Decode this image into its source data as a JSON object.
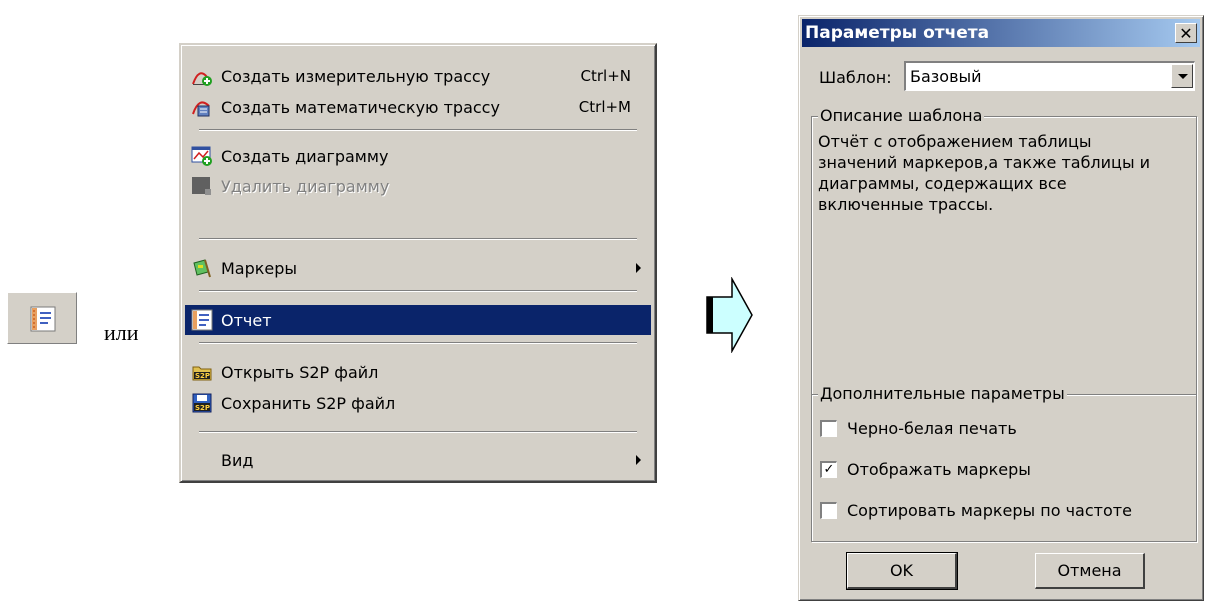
{
  "toolbar": {
    "report_icon": "report-icon",
    "or_text": "или"
  },
  "menu": {
    "items": [
      {
        "label": "Создать измерительную трассу",
        "shortcut": "Ctrl+N",
        "icon": "measure-trace-icon"
      },
      {
        "label": "Создать математическую трассу",
        "shortcut": "Ctrl+M",
        "icon": "math-trace-icon"
      },
      {
        "label": "Создать диаграмму",
        "icon": "create-chart-icon"
      },
      {
        "label": "Удалить диаграмму",
        "icon": "delete-chart-icon",
        "disabled": true
      },
      {
        "label": "Маркеры",
        "icon": "markers-icon",
        "submenu": true
      },
      {
        "label": "Отчет",
        "icon": "report-icon",
        "selected": true
      },
      {
        "label": "Открыть S2P файл",
        "icon": "open-s2p-icon"
      },
      {
        "label": "Сохранить S2P файл",
        "icon": "save-s2p-icon"
      },
      {
        "label": "Вид",
        "submenu": true
      }
    ]
  },
  "dialog": {
    "title": "Параметры отчета",
    "template_label": "Шаблон:",
    "template_value": "Базовый",
    "description_group": "Описание шаблона",
    "description_lines": [
      "Отчёт с отображением таблицы",
      "значений маркеров,а также таблицы и",
      "диаграммы, содержащих все",
      "включенные трассы."
    ],
    "extra_group": "Дополнительные параметры",
    "options": [
      {
        "label": "Черно-белая печать",
        "checked": false
      },
      {
        "label": "Отображать маркеры",
        "checked": true
      },
      {
        "label": "Сортировать маркеры по частоте",
        "checked": false
      }
    ],
    "ok_label": "OK",
    "cancel_label": "Отмена"
  },
  "colors": {
    "menu_bg": "#d4d0c8",
    "selection": "#0a246a",
    "title_gradient_start": "#0a246a",
    "title_gradient_end": "#a6caf0",
    "arrow_fill": "#ccffff"
  }
}
